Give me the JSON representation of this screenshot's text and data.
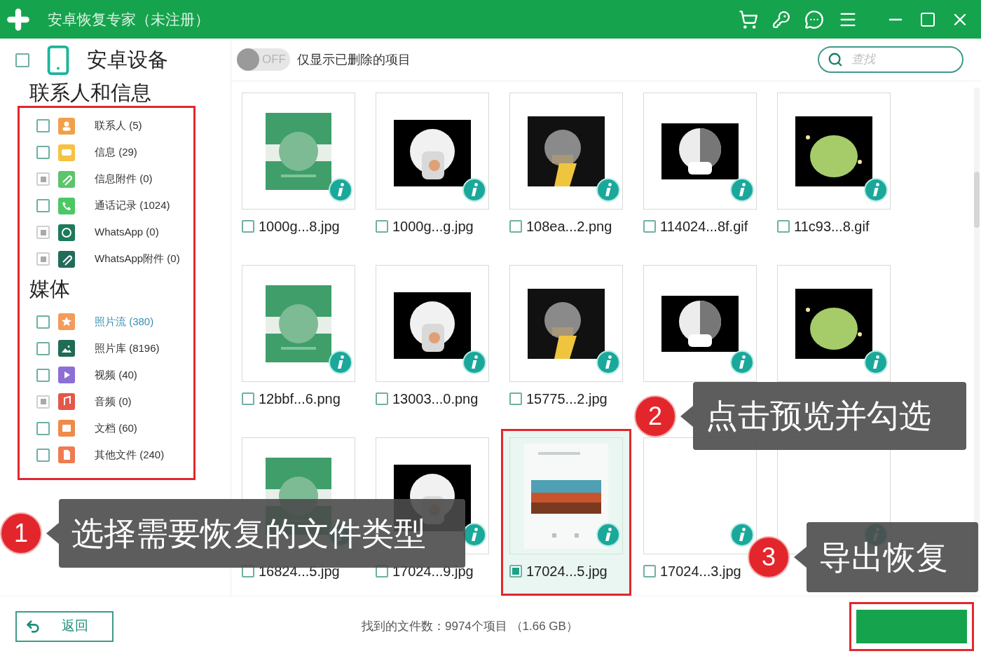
{
  "window": {
    "title": "安卓恢复专家（未注册）"
  },
  "sidebar": {
    "device": {
      "label": "安卓设备",
      "checked": false
    },
    "groups": [
      {
        "title": "联系人和信息",
        "items": [
          {
            "label": "联系人 (5)",
            "kind": "contact",
            "color": "#f0a04b",
            "disabled": false,
            "selected": false
          },
          {
            "label": "信息 (29)",
            "kind": "message",
            "color": "#f5c242",
            "disabled": false,
            "selected": false
          },
          {
            "label": "信息附件 (0)",
            "kind": "clip",
            "color": "#5cc46a",
            "disabled": true,
            "selected": false
          },
          {
            "label": "通话记录 (1024)",
            "kind": "call",
            "color": "#4cc765",
            "disabled": false,
            "selected": false
          },
          {
            "label": "WhatsApp (0)",
            "kind": "chat",
            "color": "#1d7a5c",
            "disabled": true,
            "selected": false
          },
          {
            "label": "WhatsApp附件 (0)",
            "kind": "clip",
            "color": "#226b5a",
            "disabled": true,
            "selected": false
          }
        ]
      },
      {
        "title": "媒体",
        "items": [
          {
            "label": "照片流 (380)",
            "kind": "star",
            "color": "#f29b5a",
            "disabled": false,
            "selected": true
          },
          {
            "label": "照片库 (8196)",
            "color": "#1f6b55",
            "disabled": false,
            "selected": false
          },
          {
            "label": "视频 (40)",
            "kind": "video",
            "color": "#8b6fd6",
            "disabled": false,
            "selected": false
          },
          {
            "label": "音频 (0)",
            "kind": "music",
            "color": "#e4584a",
            "disabled": true,
            "selected": false
          },
          {
            "label": "文档 (60)",
            "kind": "folder",
            "color": "#f08a4b",
            "disabled": false,
            "selected": false
          },
          {
            "label": "其他文件 (240)",
            "kind": "file",
            "color": "#ef7b52",
            "disabled": false,
            "selected": false
          }
        ]
      }
    ]
  },
  "toolbar": {
    "toggle": {
      "label": "OFF",
      "on": false
    },
    "toggle_text": "仅显示已删除的项目",
    "search": {
      "placeholder": "查找"
    }
  },
  "files": [
    {
      "label": "1000g...8.jpg",
      "checked": false,
      "selected": false
    },
    {
      "label": "1000g...g.jpg",
      "checked": false,
      "selected": false
    },
    {
      "label": "108ea...2.png",
      "checked": false,
      "selected": false
    },
    {
      "label": "114024...8f.gif",
      "checked": false,
      "selected": false
    },
    {
      "label": "11c93...8.gif",
      "checked": false,
      "selected": false
    },
    {
      "label": "12bbf...6.png",
      "checked": false,
      "selected": false
    },
    {
      "label": "13003...0.png",
      "checked": false,
      "selected": false
    },
    {
      "label": "15775...2.jpg",
      "checked": false,
      "selected": false
    },
    {
      "selected": false
    },
    {
      "selected": false
    },
    {
      "label": "16824...5.jpg",
      "checked": false,
      "selected": false
    },
    {
      "label": "17024...9.jpg",
      "checked": false,
      "selected": false
    },
    {
      "label": "17024...5.jpg",
      "checked": true,
      "selected": true
    },
    {
      "label": "17024...3.jpg",
      "checked": false,
      "selected": false
    },
    {
      "selected": false
    }
  ],
  "footer": {
    "back_button": "返回",
    "status": "找到的文件数：9974个项目 （1.66 GB）"
  },
  "callouts": [
    {
      "number": "1",
      "text": "选择需要恢复的文件类型"
    },
    {
      "number": "2",
      "text": "点击预览并勾选"
    },
    {
      "number": "3",
      "text": "导出恢复"
    }
  ]
}
